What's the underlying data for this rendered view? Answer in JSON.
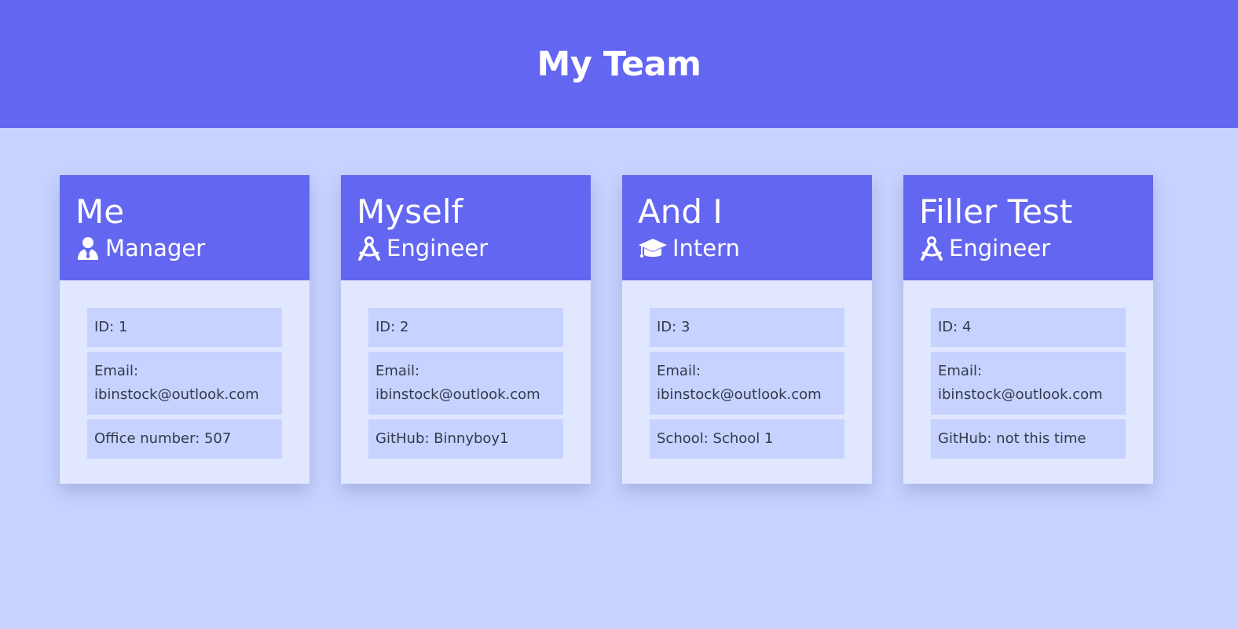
{
  "header": {
    "title": "My Team"
  },
  "colors": {
    "primary": "#6366f1",
    "background": "#c7d2fe",
    "card_body": "#e0e7ff"
  },
  "team": [
    {
      "name": "Me",
      "role": "Manager",
      "icon": "manager-user-tie-icon",
      "id_text": "ID: 1",
      "email_label": "Email:",
      "email": "ibinstock@outlook.com",
      "extra": "Office number: 507"
    },
    {
      "name": "Myself",
      "role": "Engineer",
      "icon": "drafting-compass-icon",
      "id_text": "ID: 2",
      "email_label": "Email:",
      "email": "ibinstock@outlook.com",
      "extra": "GitHub: Binnyboy1"
    },
    {
      "name": "And I",
      "role": "Intern",
      "icon": "graduation-cap-icon",
      "id_text": "ID: 3",
      "email_label": "Email:",
      "email": "ibinstock@outlook.com",
      "extra": "School: School 1"
    },
    {
      "name": "Filler Test",
      "role": "Engineer",
      "icon": "drafting-compass-icon",
      "id_text": "ID: 4",
      "email_label": "Email:",
      "email": "ibinstock@outlook.com",
      "extra": "GitHub: not this time"
    }
  ]
}
